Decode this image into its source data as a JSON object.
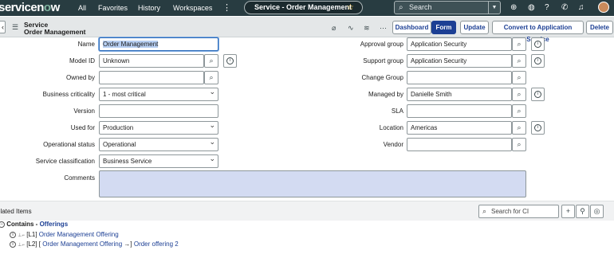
{
  "topbar": {
    "logo": "servicenow",
    "nav": [
      "All",
      "Favorites",
      "History",
      "Workspaces"
    ],
    "kebab": "⋮",
    "context_title": "Service - Order Management",
    "search_placeholder": "Search"
  },
  "header": {
    "title_line1": "Service",
    "title_line2": "Order Management",
    "buttons": {
      "dashboard": "Dashboard",
      "form": "Form",
      "update": "Update",
      "convert": "Convert to Application Service",
      "delete": "Delete"
    }
  },
  "left_fields": {
    "name": {
      "label": "Name",
      "value": "Order Management"
    },
    "model_id": {
      "label": "Model ID",
      "value": "Unknown"
    },
    "owned_by": {
      "label": "Owned by",
      "value": ""
    },
    "business_criticality": {
      "label": "Business criticality",
      "value": "1 - most critical"
    },
    "version": {
      "label": "Version",
      "value": ""
    },
    "used_for": {
      "label": "Used for",
      "value": "Production"
    },
    "operational_status": {
      "label": "Operational status",
      "value": "Operational"
    },
    "service_classification": {
      "label": "Service classification",
      "value": "Business Service"
    },
    "comments": {
      "label": "Comments",
      "value": ""
    }
  },
  "right_fields": {
    "approval_group": {
      "label": "Approval group",
      "value": "Application Security"
    },
    "support_group": {
      "label": "Support group",
      "value": "Application Security"
    },
    "change_group": {
      "label": "Change Group",
      "value": ""
    },
    "managed_by": {
      "label": "Managed by",
      "value": "Danielle Smith"
    },
    "sla": {
      "label": "SLA",
      "value": ""
    },
    "location": {
      "label": "Location",
      "value": "Americas"
    },
    "vendor": {
      "label": "Vendor",
      "value": ""
    }
  },
  "related": {
    "title": "elated Items",
    "search_placeholder": "Search for CI",
    "contains_label": "Contains - ",
    "contains_link": "Offerings",
    "rows": [
      {
        "level": "[L1]",
        "link": "Order Management Offering"
      },
      {
        "level": "[L2] [",
        "link": "Order Management Offering",
        "arrow": "→]",
        "child": "Order offering 2"
      }
    ]
  },
  "colors": {
    "topbar": "#283c41",
    "accent": "#1c3f94",
    "comments_bg": "#d3dbf2"
  }
}
